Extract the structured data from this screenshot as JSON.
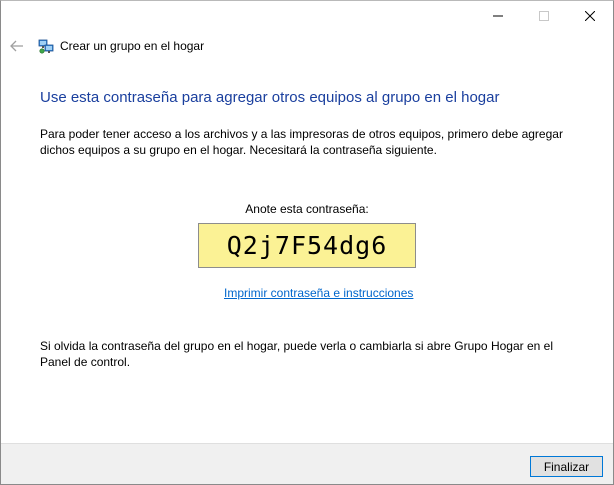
{
  "window": {
    "caption_buttons": [
      "minimize-icon",
      "maximize-icon",
      "close-icon"
    ]
  },
  "nav": {
    "back_icon": "back-arrow-icon",
    "app_icon": "homegroup-icon",
    "title": "Crear un grupo en el hogar"
  },
  "content": {
    "heading": "Use esta contraseña para agregar otros equipos al grupo en el hogar",
    "description": "Para poder tener acceso a los archivos y a las impresoras de otros equipos, primero debe agregar dichos equipos a su grupo en el hogar. Necesitará la contraseña siguiente.",
    "password_label": "Anote esta contraseña:",
    "password": "Q2j7F54dg6",
    "print_link": "Imprimir contraseña e instrucciones",
    "note": "Si olvida la contraseña del grupo en el hogar, puede verla o cambiarla si abre Grupo Hogar en el Panel de control."
  },
  "footer": {
    "finish_label": "Finalizar"
  },
  "colors": {
    "heading": "#1a3f9e",
    "link": "#0066cc",
    "password_bg": "#fbf295",
    "button_border": "#0078d7"
  }
}
